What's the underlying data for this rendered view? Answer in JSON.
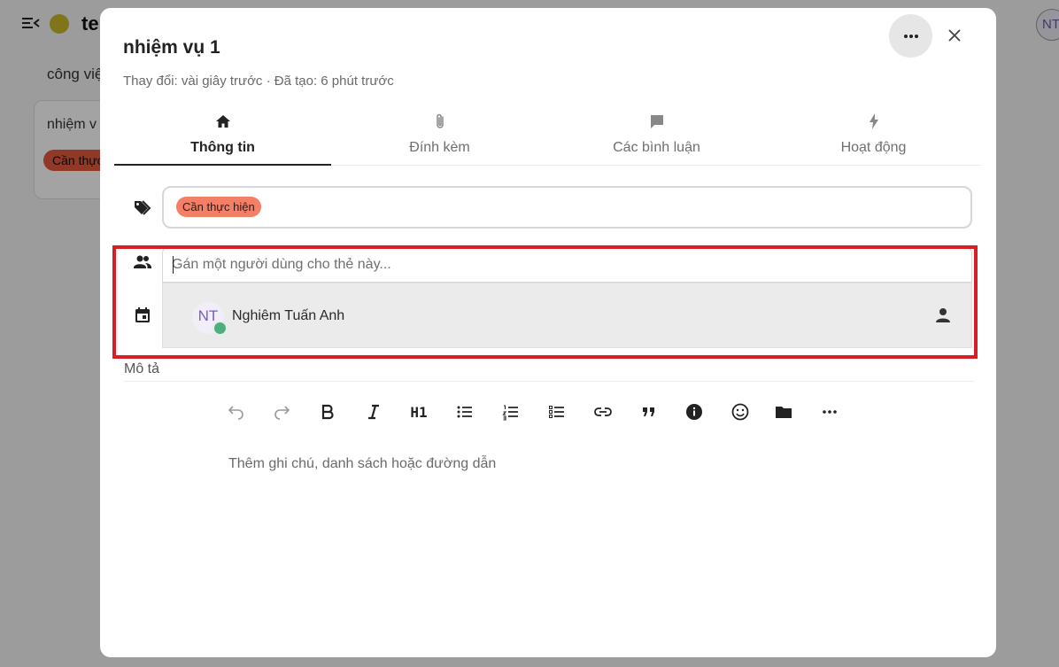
{
  "background": {
    "board_title": "te",
    "column_title": "công việ",
    "card_title": "nhiệm v",
    "card_tag": "Cần thực",
    "avatar_initials": "NT"
  },
  "modal": {
    "title": "nhiệm vụ 1",
    "subtitle": "Thay đổi: vài giây trước · Đã tạo: 6 phút trước",
    "tabs": [
      {
        "label": "Thông tin",
        "icon": "home-icon",
        "active": true
      },
      {
        "label": "Đính kèm",
        "icon": "paperclip-icon",
        "active": false
      },
      {
        "label": "Các bình luận",
        "icon": "comment-icon",
        "active": false
      },
      {
        "label": "Hoạt động",
        "icon": "lightning-icon",
        "active": false
      }
    ],
    "labels": {
      "tag": "Cần thực hiện",
      "tag_color": "#f47f67"
    },
    "assign": {
      "placeholder": "Gán một người dùng cho thẻ này...",
      "value": "",
      "options": [
        {
          "initials": "NT",
          "name": "Nghiêm Tuấn Anh",
          "status_color": "#4caf7d"
        }
      ]
    },
    "description": {
      "label": "Mô tả",
      "placeholder": "Thêm ghi chú, danh sách hoặc đường dẫn",
      "toolbar": {
        "h1_label": "H1"
      }
    },
    "highlight_color": "#d81e22"
  }
}
